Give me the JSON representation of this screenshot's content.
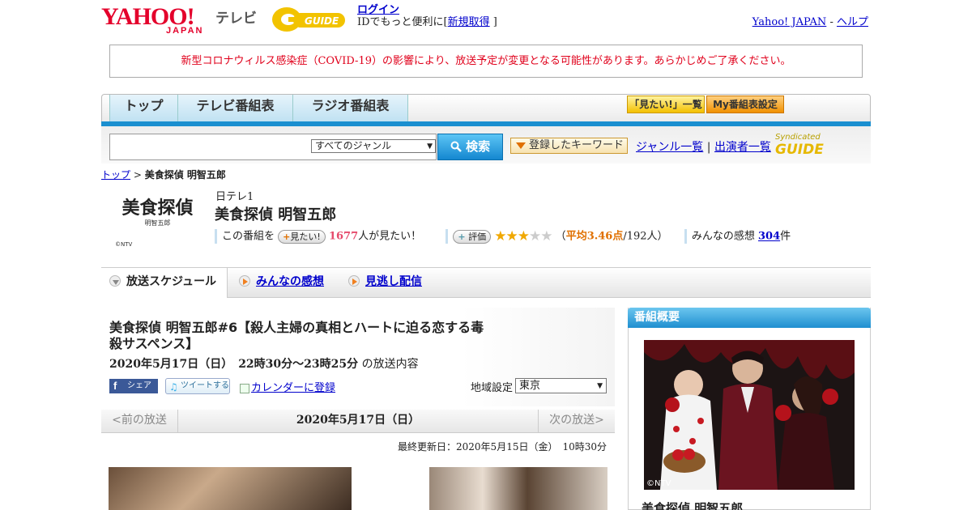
{
  "header": {
    "logo_yahoo": "YAHOO!",
    "logo_japan": "JAPAN",
    "logo_tv": "テレビ",
    "logo_gguide": "GUIDE",
    "login_link": "ログイン",
    "login_text_prefix": "IDでもっと便利に[",
    "signup_link": "新規取得",
    "login_text_suffix": "]",
    "yahoo_japan_link": "Yahoo! JAPAN",
    "separator": "-",
    "help_link": "ヘルプ"
  },
  "notice": "新型コロナウィルス感染症（COVID-19）の影響により、放送予定が変更となる可能性があります。あらかじめご了承ください。",
  "nav": {
    "tabs": [
      "トップ",
      "テレビ番組表",
      "ラジオ番組表"
    ],
    "mitai_button": "「見たい!」一覧",
    "my_button": "My番組表設定"
  },
  "search": {
    "genre": "すべてのジャンル",
    "button": "検索",
    "keyword_button": "登録したキーワード",
    "genre_link": "ジャンル一覧",
    "link_sep": "|",
    "cast_link": "出演者一覧",
    "syndicated": "Syndicated",
    "syndicated_logo": "GUIDE"
  },
  "breadcrumb": {
    "top": "トップ",
    "sep": ">",
    "current": "美食探偵 明智五郎"
  },
  "program": {
    "logo_title": "美食探偵",
    "logo_sub": "明智五郎",
    "logo_copyright": "©NTV",
    "channel": "日テレ1",
    "title": "美食探偵 明智五郎",
    "mitai_prefix": "この番組を",
    "mitai_button": "見たい!",
    "mitai_count": "1677",
    "mitai_suffix": "人が見たい！",
    "rating_button": "評価",
    "rating": 3.46,
    "rating_open": "（",
    "rating_avg": "平均3.46点",
    "rating_count": "/192人）",
    "reviews_prefix": "みんなの感想",
    "reviews_count": "304",
    "reviews_suffix": "件"
  },
  "tabs": {
    "schedule": "放送スケジュール",
    "reviews": "みんなの感想",
    "vod": "見逃し配信"
  },
  "episode": {
    "title": "美食探偵 明智五郎#6【殺人主婦の真相とハートに迫る恋する毒殺サスペンス】",
    "date": "2020年5月17日（日）　22時30分～23時25分",
    "date_suffix": "の放送内容",
    "share_fb": "シェア",
    "share_tw": "ツイートする",
    "calendar": "カレンダーに登録",
    "region_label": "地域設定",
    "region": "東京"
  },
  "pager": {
    "prev": "<前の放送",
    "current": "2020年5月17日（日）",
    "next": "次の放送>"
  },
  "updated": "最終更新日：2020年5月15日（金）　10時30分",
  "sidebar": {
    "heading": "番組概要",
    "image_credit": "©NTV",
    "title": "美食探偵 明智五郎"
  },
  "colors": {
    "accent_blue": "#1a8fd0",
    "notice_red": "#e0001b",
    "link": "#0000cc"
  }
}
